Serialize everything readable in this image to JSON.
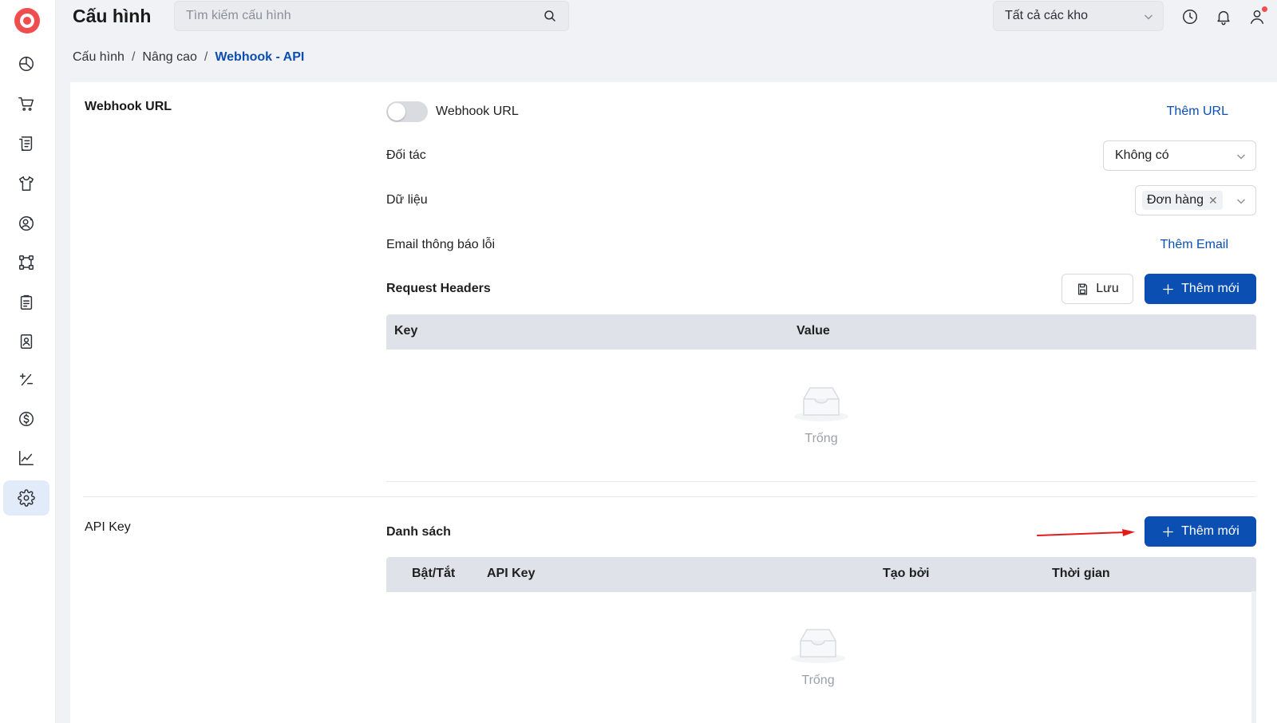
{
  "header": {
    "title": "Cấu hình",
    "search_placeholder": "Tìm kiếm cấu hình",
    "warehouse_select": "Tất cả các kho"
  },
  "icons": {
    "search": "search-icon",
    "clock": "clock-icon",
    "bell": "bell-icon",
    "user": "user-icon",
    "chevron": "chevron-down-icon"
  },
  "breadcrumb": {
    "items": [
      "Cấu hình",
      "Nâng cao",
      "Webhook - API"
    ],
    "separator": "/"
  },
  "sidebar": {
    "items": [
      {
        "name": "dashboard",
        "icon": "pie-chart-icon"
      },
      {
        "name": "orders",
        "icon": "cart-icon"
      },
      {
        "name": "invoices",
        "icon": "receipt-icon"
      },
      {
        "name": "products",
        "icon": "shirt-icon"
      },
      {
        "name": "customers",
        "icon": "user-settings-icon"
      },
      {
        "name": "integrations",
        "icon": "nodes-icon"
      },
      {
        "name": "tasks",
        "icon": "clipboard-icon"
      },
      {
        "name": "contacts",
        "icon": "contact-card-icon"
      },
      {
        "name": "calculations",
        "icon": "plus-minus-icon"
      },
      {
        "name": "finance",
        "icon": "dollar-icon"
      },
      {
        "name": "reports",
        "icon": "line-chart-icon"
      },
      {
        "name": "settings",
        "icon": "gear-icon",
        "active": true
      }
    ]
  },
  "webhook": {
    "section_title": "Webhook URL",
    "toggle_label": "Webhook URL",
    "toggle_on": false,
    "add_url": "Thêm URL",
    "partner_label": "Đối tác",
    "partner_value": "Không có",
    "data_label": "Dữ liệu",
    "data_tag": "Đơn hàng",
    "error_email_label": "Email thông báo lỗi",
    "add_email": "Thêm Email",
    "headers_title": "Request Headers",
    "save_button": "Lưu",
    "add_new_button": "Thêm mới",
    "columns": [
      "Key",
      "Value"
    ],
    "empty_text": "Trống"
  },
  "api_key": {
    "section_title": "API Key",
    "list_title": "Danh sách",
    "add_new_button": "Thêm mới",
    "columns": [
      "Bật/Tắt",
      "API Key",
      "Tạo bởi",
      "Thời gian"
    ],
    "empty_text": "Trống"
  },
  "colors": {
    "primary": "#0b4fb3",
    "logo": "#f04e4e",
    "annotation_arrow": "#e31b1b"
  }
}
